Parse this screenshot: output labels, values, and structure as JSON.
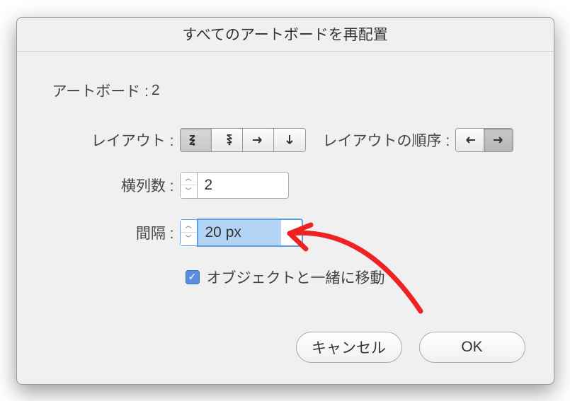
{
  "dialog": {
    "title": "すべてのアートボードを再配置"
  },
  "artboards": {
    "label": "アートボード :",
    "count": "2"
  },
  "layout": {
    "label": "レイアウト :",
    "order_label": "レイアウトの順序 :"
  },
  "columns": {
    "label": "横列数 :",
    "value": "2"
  },
  "spacing": {
    "label": "間隔 :",
    "value": "20 px"
  },
  "move_objects": {
    "label": "オブジェクトと一緒に移動",
    "checked": true
  },
  "buttons": {
    "cancel": "キャンセル",
    "ok": "OK"
  }
}
